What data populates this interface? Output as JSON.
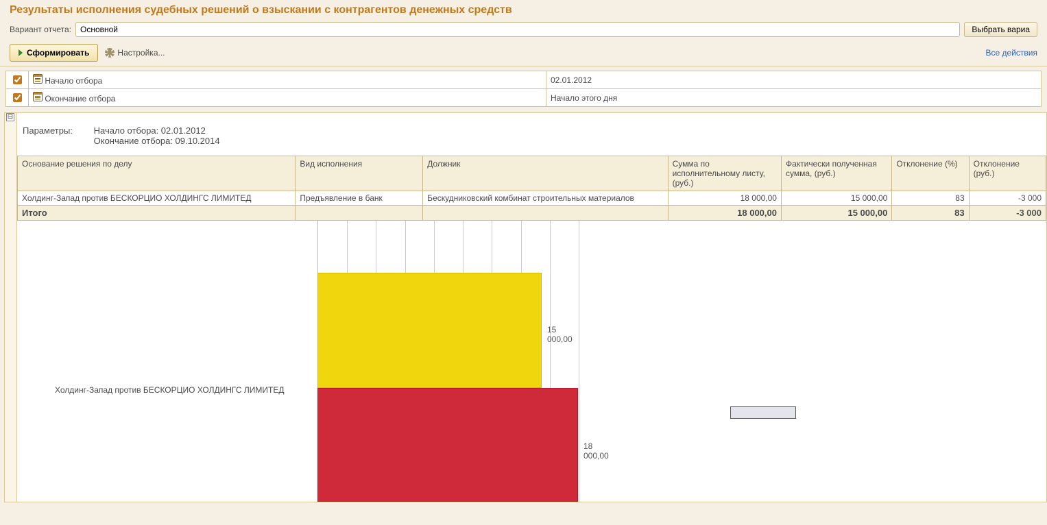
{
  "title": "Результаты исполнения судебных решений о взыскании с контрагентов денежных средств",
  "variant": {
    "label": "Вариант отчета:",
    "value": "Основной",
    "select_button": "Выбрать вариа"
  },
  "toolbar": {
    "generate": "Сформировать",
    "settings": "Настройка...",
    "all_actions": "Все действия"
  },
  "filters": [
    {
      "checked": true,
      "name": "Начало отбора",
      "value": "02.01.2012"
    },
    {
      "checked": true,
      "name": "Окончание отбора",
      "value": "Начало этого дня"
    }
  ],
  "params": {
    "label": "Параметры:",
    "line1": "Начало отбора: 02.01.2012",
    "line2": "Окончание отбора: 09.10.2014"
  },
  "columns": [
    "Основание решения по делу",
    "Вид исполнения",
    "Должник",
    "Сумма по исполнительному листу, (руб.)",
    "Фактически полученная сумма, (руб.)",
    "Отклонение (%)",
    "Отклонение (руб.)"
  ],
  "rows": [
    {
      "case": "Холдинг-Запад против БЕСКОРЦИО ХОЛДИНГС ЛИМИТЕД",
      "exec": "Предъявление в банк",
      "debtor": "Бескудниковский комбинат строительных материалов",
      "sum": "18 000,00",
      "actual": "15 000,00",
      "dev_pct": "83",
      "dev_rub": "-3 000"
    }
  ],
  "total": {
    "label": "Итого",
    "sum": "18 000,00",
    "actual": "15 000,00",
    "dev_pct": "83",
    "dev_rub": "-3 000"
  },
  "collapse_symbol": "⊟",
  "chart_data": {
    "type": "bar",
    "orientation": "horizontal",
    "categories": [
      "Холдинг-Запад против БЕСКОРЦИО ХОЛДИНГС ЛИМИТЕД"
    ],
    "series": [
      {
        "name": "Фактически полученная сумма",
        "values": [
          15000
        ],
        "label": "15 000,00",
        "color": "#f0d70d"
      },
      {
        "name": "Сумма по исполнительному листу",
        "values": [
          18000
        ],
        "label": "18 000,00",
        "color": "#cf2a3a"
      }
    ],
    "xlim": [
      0,
      20000
    ],
    "grid_vlines": 9
  }
}
